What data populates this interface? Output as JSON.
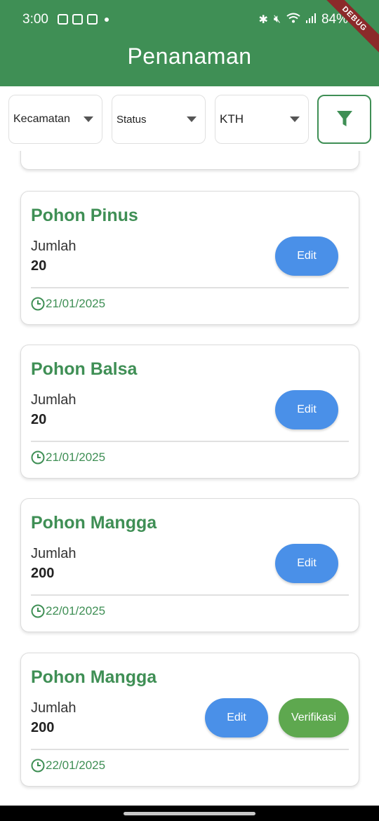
{
  "status_bar": {
    "time": "3:00",
    "battery": "84%"
  },
  "debug_banner": "DEBUG",
  "app_bar": {
    "title": "Penanaman"
  },
  "filters": {
    "kecamatan": "Kecamatan",
    "status": "Status",
    "kth": "KTH"
  },
  "colors": {
    "primary": "#3f8f55",
    "edit": "#4a90e8",
    "verify": "#5ea84f"
  },
  "items": [
    {
      "name": "Pohon Pinus",
      "qty_label": "Jumlah",
      "qty": "20",
      "date": "21/01/2025",
      "edit": "Edit"
    },
    {
      "name": "Pohon Balsa",
      "qty_label": "Jumlah",
      "qty": "20",
      "date": "21/01/2025",
      "edit": "Edit"
    },
    {
      "name": "Pohon Mangga",
      "qty_label": "Jumlah",
      "qty": "200",
      "date": "22/01/2025",
      "edit": "Edit"
    },
    {
      "name": "Pohon Mangga",
      "qty_label": "Jumlah",
      "qty": "200",
      "date": "22/01/2025",
      "edit": "Edit",
      "verify": "Verifikasi"
    }
  ]
}
